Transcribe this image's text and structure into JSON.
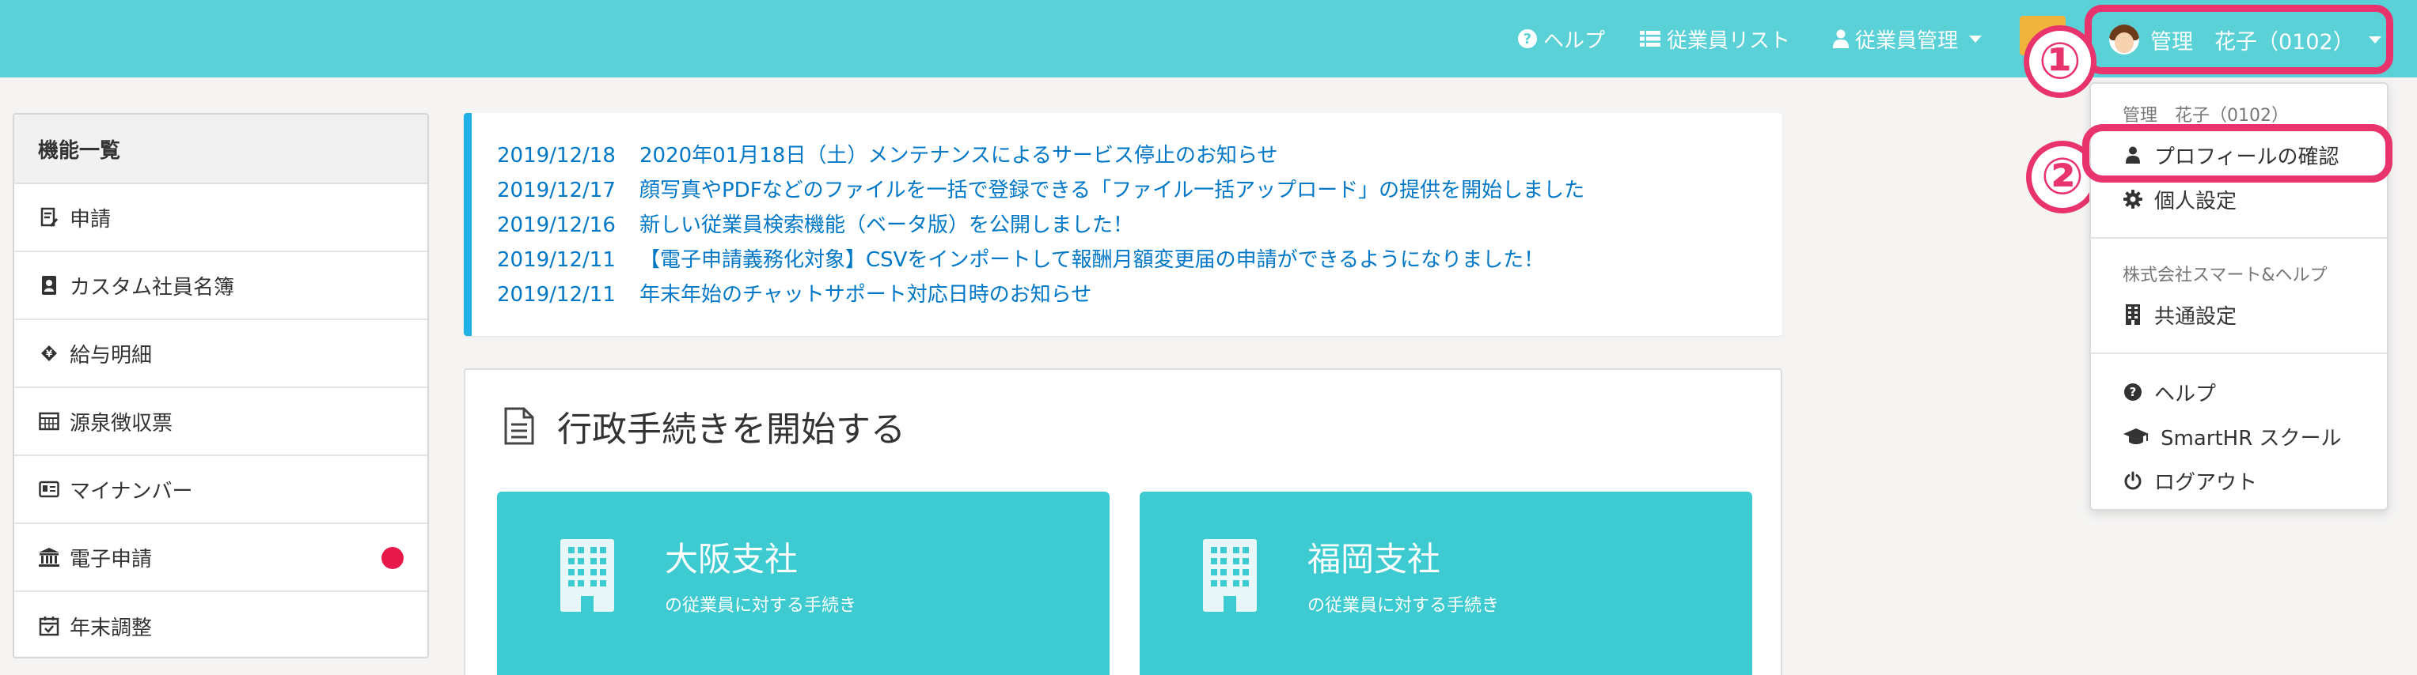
{
  "header": {
    "nav": {
      "help": "ヘルプ",
      "employee_list": "従業員リスト",
      "employee_management": "従業員管理"
    },
    "user": {
      "name": "管理　花子（0102）"
    }
  },
  "steps": {
    "one": "①",
    "two": "②"
  },
  "sidebar": {
    "title": "機能一覧",
    "items": [
      {
        "label": "申請",
        "icon": "form-icon"
      },
      {
        "label": "カスタム社員名簿",
        "icon": "contact-book-icon"
      },
      {
        "label": "給与明細",
        "icon": "yen-coin-icon"
      },
      {
        "label": "源泉徴収票",
        "icon": "calculator-icon"
      },
      {
        "label": "マイナンバー",
        "icon": "id-card-icon"
      },
      {
        "label": "電子申請",
        "icon": "government-building-icon",
        "badge": true
      },
      {
        "label": "年末調整",
        "icon": "calendar-check-icon"
      }
    ]
  },
  "news": [
    {
      "date": "2019/12/18",
      "text": "2020年01月18日（土）メンテナンスによるサービス停止のお知らせ"
    },
    {
      "date": "2019/12/17",
      "text": "顔写真やPDFなどのファイルを一括で登録できる「ファイル一括アップロード」の提供を開始しました"
    },
    {
      "date": "2019/12/16",
      "text": "新しい従業員検索機能（ベータ版）を公開しました！"
    },
    {
      "date": "2019/12/11",
      "text": "【電子申請義務化対象】CSVをインポートして報酬月額変更届の申請ができるようになりました！"
    },
    {
      "date": "2019/12/11",
      "text": "年末年始のチャットサポート対応日時のお知らせ"
    }
  ],
  "procedures": {
    "title": "行政手続きを開始する",
    "offices": [
      {
        "name": "大阪支社",
        "sub": "の従業員に対する手続き"
      },
      {
        "name": "福岡支社",
        "sub": "の従業員に対する手続き"
      }
    ]
  },
  "dropdown": {
    "user_caption": "管理　花子（0102）",
    "profile": "プロフィールの確認",
    "personal_settings": "個人設定",
    "company_caption": "株式会社スマート&ヘルプ",
    "common_settings": "共通設定",
    "help": "ヘルプ",
    "school": "SmartHR スクール",
    "logout": "ログアウト"
  },
  "colors": {
    "header": "#5ad1d6",
    "card": "#3dcbd1",
    "link": "#0077c7",
    "highlight": "#e8336d",
    "news_border": "#1fb1e6",
    "badge": "#e8194a"
  }
}
